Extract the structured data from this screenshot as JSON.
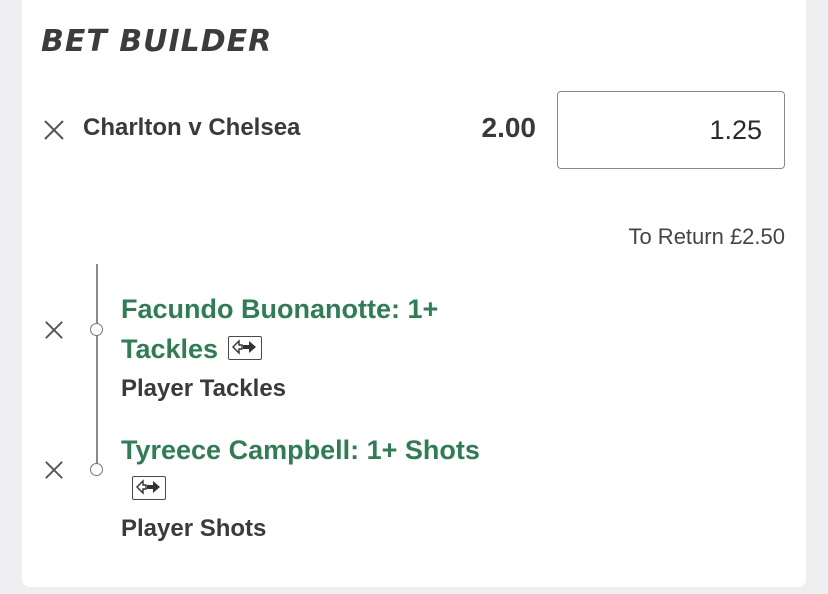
{
  "header": {
    "title": "BET BUILDER"
  },
  "bet": {
    "match": "Charlton v Chelsea",
    "odds": "2.00",
    "stake_value": "1.25",
    "returns_text": "To Return £2.50"
  },
  "selections": [
    {
      "line1": "Facundo Buonanotte: 1+",
      "line2": "Tackles",
      "market": "Player Tackles",
      "icon": "swap-icon"
    },
    {
      "line1": "Tyreece Campbell: 1+ Shots",
      "market": "Player Shots",
      "icon": "swap-icon"
    }
  ],
  "colors": {
    "selection_green": "#2e7d53",
    "text_dark": "#3a3a3a",
    "page_bg": "#efeff1",
    "card_bg": "#ffffff"
  }
}
